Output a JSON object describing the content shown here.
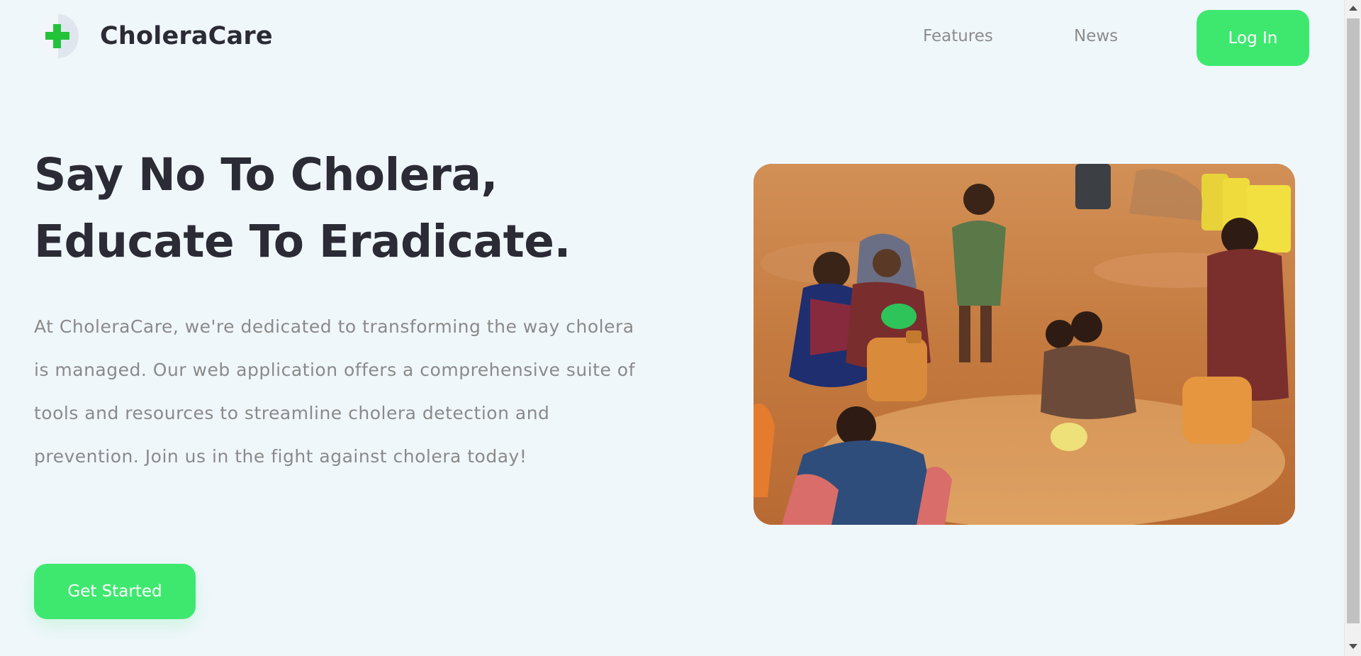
{
  "header": {
    "brand_name": "CholeraCare",
    "nav": {
      "features": "Features",
      "news": "News"
    },
    "login_label": "Log In"
  },
  "hero": {
    "headline_line1": "Say No To Cholera,",
    "headline_line2": "Educate To Eradicate.",
    "intro": "At CholeraCare, we're dedicated to transforming the way cholera is managed. Our web application offers a comprehensive suite of tools and resources to streamline cholera detection and prevention. Join us in the fight against cholera today!",
    "cta_label": "Get Started"
  },
  "colors": {
    "background": "#f0f7fb",
    "accent": "#3ee86f",
    "heading": "#2b2b35",
    "body_text": "#8a8a8a",
    "nav_text": "#8c8c8c"
  },
  "icons": {
    "logo": "green-cross-icon",
    "scroll_up": "arrow-up-icon",
    "scroll_down": "arrow-down-icon"
  }
}
